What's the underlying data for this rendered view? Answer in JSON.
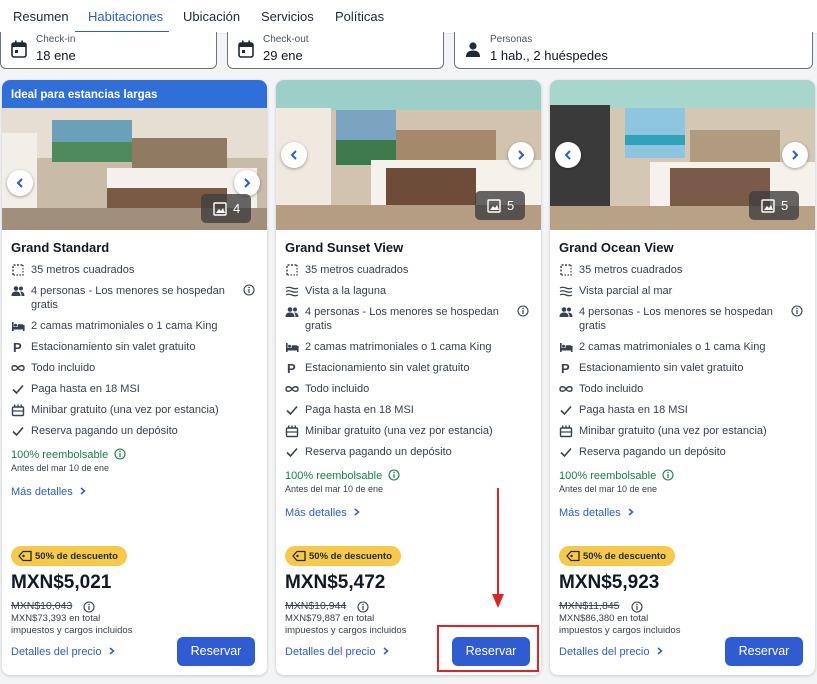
{
  "tabs": [
    "Resumen",
    "Habitaciones",
    "Ubicación",
    "Servicios",
    "Políticas"
  ],
  "search": {
    "checkin": {
      "label": "Check-in",
      "value": "18 ene"
    },
    "checkout": {
      "label": "Check-out",
      "value": "29 ene"
    },
    "guests": {
      "label": "Personas",
      "value": "1 hab., 2 huéspedes"
    }
  },
  "cards": [
    {
      "banner": "Ideal para estancias largas",
      "photo_count": "4",
      "name": "Grand Standard",
      "features": [
        {
          "icon": "area-icon",
          "text": "35 metros cuadrados"
        },
        {
          "icon": "people-icon",
          "text": "4 personas - Los menores se hospedan gratis",
          "info": true
        },
        {
          "icon": "bed-icon",
          "text": "2 camas matrimoniales o 1 cama King"
        },
        {
          "icon": "parking-icon",
          "text": "Estacionamiento sin valet gratuito"
        },
        {
          "icon": "infinity-icon",
          "text": "Todo incluido"
        },
        {
          "icon": "check-icon",
          "text": "Paga hasta en 18 MSI"
        },
        {
          "icon": "minibar-icon",
          "text": "Minibar gratuito (una vez por estancia)"
        },
        {
          "icon": "check-icon",
          "text": "Reserva pagando un depósito"
        }
      ],
      "refund": "100% reembolsable",
      "refund_note": "Antes del mar 10 de ene",
      "more": "Más detalles",
      "discount": "50% de descuento",
      "price": "MXN$5,021",
      "old_price": "MXN$10,043",
      "total_line1": "MXN$73,393 en total",
      "total_line2": "impuestos y cargos incluidos",
      "price_details": "Detalles del precio",
      "reserve": "Reservar"
    },
    {
      "banner": "",
      "photo_count": "5",
      "name": "Grand Sunset View",
      "features": [
        {
          "icon": "area-icon",
          "text": "35 metros cuadrados"
        },
        {
          "icon": "waves-icon",
          "text": "Vista a la laguna"
        },
        {
          "icon": "people-icon",
          "text": "4 personas - Los menores se hospedan gratis",
          "info": true
        },
        {
          "icon": "bed-icon",
          "text": "2 camas matrimoniales o 1 cama King"
        },
        {
          "icon": "parking-icon",
          "text": "Estacionamiento sin valet gratuito"
        },
        {
          "icon": "infinity-icon",
          "text": "Todo incluido"
        },
        {
          "icon": "check-icon",
          "text": "Paga hasta en 18 MSI"
        },
        {
          "icon": "minibar-icon",
          "text": "Minibar gratuito (una vez por estancia)"
        },
        {
          "icon": "check-icon",
          "text": "Reserva pagando un depósito"
        }
      ],
      "refund": "100% reembolsable",
      "refund_note": "Antes del mar 10 de ene",
      "more": "Más detalles",
      "discount": "50% de descuento",
      "price": "MXN$5,472",
      "old_price": "MXN$10,944",
      "total_line1": "MXN$79,887 en total",
      "total_line2": "impuestos y cargos incluidos",
      "price_details": "Detalles del precio",
      "reserve": "Reservar"
    },
    {
      "banner": "",
      "photo_count": "5",
      "name": "Grand Ocean View",
      "features": [
        {
          "icon": "area-icon",
          "text": "35 metros cuadrados"
        },
        {
          "icon": "waves-icon",
          "text": "Vista parcial al mar"
        },
        {
          "icon": "people-icon",
          "text": "4 personas - Los menores se hospedan gratis",
          "info": true
        },
        {
          "icon": "bed-icon",
          "text": "2 camas matrimoniales o 1 cama King"
        },
        {
          "icon": "parking-icon",
          "text": "Estacionamiento sin valet gratuito"
        },
        {
          "icon": "infinity-icon",
          "text": "Todo incluido"
        },
        {
          "icon": "check-icon",
          "text": "Paga hasta en 18 MSI"
        },
        {
          "icon": "minibar-icon",
          "text": "Minibar gratuito (una vez por estancia)"
        },
        {
          "icon": "check-icon",
          "text": "Reserva pagando un depósito"
        }
      ],
      "refund": "100% reembolsable",
      "refund_note": "Antes del mar 10 de ene",
      "more": "Más detalles",
      "discount": "50% de descuento",
      "price": "MXN$5,923",
      "old_price": "MXN$11,845",
      "total_line1": "MXN$86,380 en total",
      "total_line2": "impuestos y cargos incluidos",
      "price_details": "Detalles del precio",
      "reserve": "Reservar"
    }
  ],
  "colors": {
    "accent": "#2f5bd3",
    "banner": "#2f6fd9",
    "badge": "#f7c948",
    "refund": "#16804a",
    "annotation": "#e02424"
  }
}
